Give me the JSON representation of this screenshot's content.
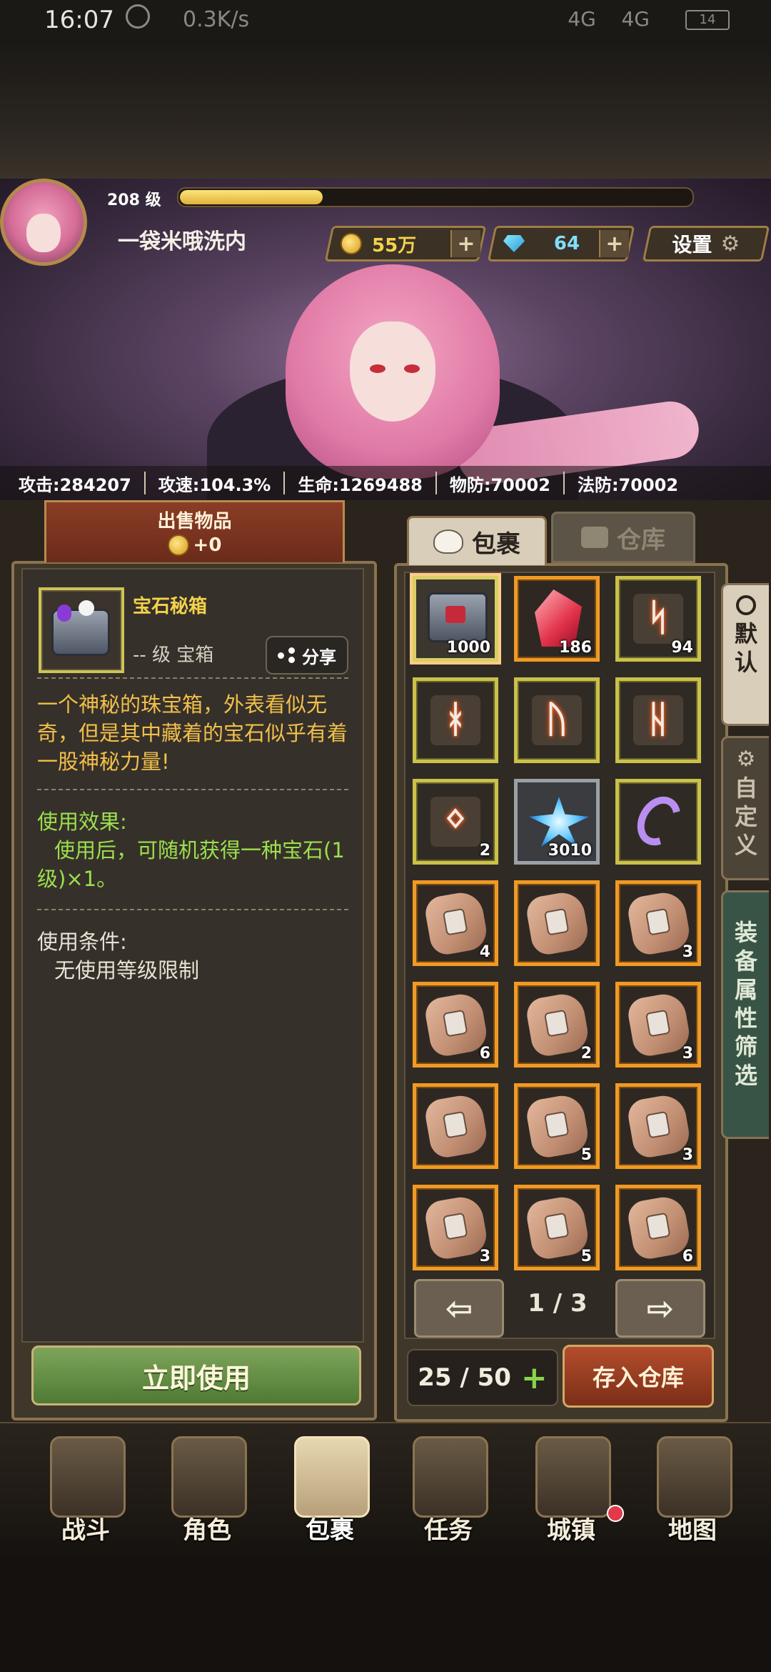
{
  "status_bar": {
    "time": "16:07",
    "net_speed": "0.3K/s",
    "signal_1": "4G",
    "signal_2": "4G",
    "battery": "14"
  },
  "player": {
    "level": "208 级",
    "xp_fraction": 0.28,
    "name": "一袋米哦洗内",
    "gold": "55万",
    "gems": "64",
    "settings_label": "设置"
  },
  "stats": [
    "攻击:284207",
    "攻速:104.3%",
    "生命:1269488",
    "物防:70002",
    "法防:70002"
  ],
  "sell": {
    "title": "出售物品",
    "price": "+0"
  },
  "item": {
    "name": "宝石秘箱",
    "level_type": "-- 级 宝箱",
    "share_label": "分享",
    "description": "一个神秘的珠宝箱，外表看似无奇，但是其中藏着的宝石似乎有着一股神秘力量!",
    "effect_title": "使用效果:",
    "effect_text": "使用后，可随机获得一种宝石(1级)×1。",
    "condition_title": "使用条件:",
    "condition_text": "无使用等级限制",
    "use_button": "立即使用"
  },
  "inventory": {
    "tab_bag": "包裹",
    "tab_warehouse": "仓库",
    "slots": [
      {
        "name": "gem-chest",
        "qty": "1000",
        "frame": "sel"
      },
      {
        "name": "red-crystal",
        "qty": "186",
        "frame": "orange"
      },
      {
        "name": "rune",
        "glyph": "ᛋ",
        "qty": "94",
        "frame": "yellow"
      },
      {
        "name": "rune",
        "glyph": "ᚼ",
        "qty": "",
        "frame": "yellow"
      },
      {
        "name": "rune",
        "glyph": "ᚢ",
        "qty": "",
        "frame": "yellow"
      },
      {
        "name": "rune",
        "glyph": "ᚺ",
        "qty": "",
        "frame": "yellow"
      },
      {
        "name": "rune",
        "glyph": "ᛜ",
        "qty": "2",
        "frame": "yellow"
      },
      {
        "name": "ice-crystal",
        "qty": "3010",
        "frame": "gray"
      },
      {
        "name": "purple-tail",
        "qty": "",
        "frame": "yellow"
      },
      {
        "name": "stone-tablet",
        "qty": "4",
        "frame": "orange"
      },
      {
        "name": "stone-tablet",
        "qty": "",
        "frame": "orange"
      },
      {
        "name": "stone-tablet",
        "qty": "3",
        "frame": "orange"
      },
      {
        "name": "stone-tablet",
        "qty": "6",
        "frame": "orange"
      },
      {
        "name": "stone-tablet",
        "qty": "2",
        "frame": "orange"
      },
      {
        "name": "stone-tablet",
        "qty": "3",
        "frame": "orange"
      },
      {
        "name": "stone-tablet",
        "qty": "",
        "frame": "orange"
      },
      {
        "name": "stone-tablet",
        "qty": "5",
        "frame": "orange"
      },
      {
        "name": "stone-tablet",
        "qty": "3",
        "frame": "orange"
      },
      {
        "name": "stone-tablet",
        "qty": "3",
        "frame": "orange"
      },
      {
        "name": "stone-tablet",
        "qty": "5",
        "frame": "orange"
      },
      {
        "name": "stone-tablet",
        "qty": "6",
        "frame": "orange"
      }
    ],
    "page": "1 / 3",
    "capacity": "25 / 50",
    "store_button": "存入仓库",
    "side_tabs": [
      "默\n认",
      "自\n定\n义",
      "装\n备\n属\n性\n筛\n选"
    ]
  },
  "nav": [
    {
      "label": "战斗",
      "active": false
    },
    {
      "label": "角色",
      "active": false
    },
    {
      "label": "包裹",
      "active": true
    },
    {
      "label": "任务",
      "active": false
    },
    {
      "label": "城镇",
      "active": false,
      "dot": true
    },
    {
      "label": "地图",
      "active": false
    }
  ],
  "colors": {
    "gold_text": "#f3d24c",
    "effect_text": "#9be04d",
    "desc_text": "#f1c04a",
    "gem_text": "#7fdfff",
    "accent_orange": "#f09a24"
  }
}
